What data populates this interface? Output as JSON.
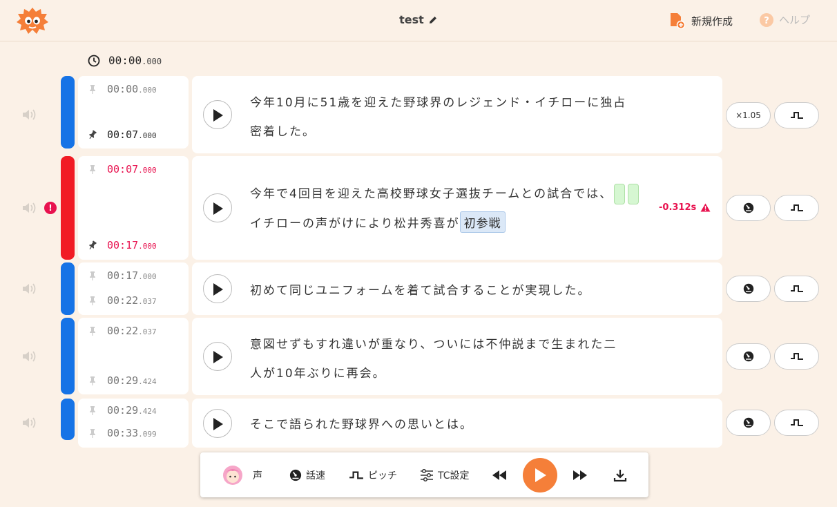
{
  "app": {
    "title": "test",
    "new_label": "新規作成",
    "help_label": "ヘルプ",
    "icons": [
      "logo-icon",
      "pencil-icon",
      "new-file-icon",
      "help-icon"
    ]
  },
  "start_time": {
    "main": "00:00",
    "ms": ".000"
  },
  "rows": [
    {
      "start": {
        "main": "00:00",
        "ms": ".000"
      },
      "end": {
        "main": "00:07",
        "ms": ".000"
      },
      "line1": "今年10月に51歳を迎えた野球界のレジェンド・イチローに独占",
      "line2": "密着した。",
      "speed": "×1.05"
    },
    {
      "start": {
        "main": "00:07",
        "ms": ".000"
      },
      "end": {
        "main": "00:17",
        "ms": ".000"
      },
      "line1": "今年で4回目を迎えた高校野球女子選抜チームとの試合では、",
      "line2a": "イチローの声がけにより松井秀喜が",
      "chip": "初参戦",
      "warning": "-0.312s",
      "error_icon": "!"
    },
    {
      "start": {
        "main": "00:17",
        "ms": ".000"
      },
      "end": {
        "main": "00:22",
        "ms": ".037"
      },
      "line1": "初めて同じユニフォームを着て試合することが実現した。"
    },
    {
      "start": {
        "main": "00:22",
        "ms": ".037"
      },
      "end": {
        "main": "00:29",
        "ms": ".424"
      },
      "line1": "意図せずもすれ違いが重なり、ついには不仲説まで生まれた二",
      "line2": "人が10年ぶりに再会。"
    },
    {
      "start": {
        "main": "00:29",
        "ms": ".424"
      },
      "end": {
        "main": "00:33",
        "ms": ".099"
      },
      "line1": "そこで語られた野球界への思いとは。"
    }
  ],
  "toolbar": {
    "voice_label": "声",
    "speed_label": "話速",
    "pitch_label": "ピッチ",
    "tc_label": "TC設定"
  },
  "colors": {
    "accent": "#f57f39",
    "blue": "#1673e6",
    "red": "#f11b24",
    "error": "#e8124f",
    "bg": "#fbf1e7"
  }
}
